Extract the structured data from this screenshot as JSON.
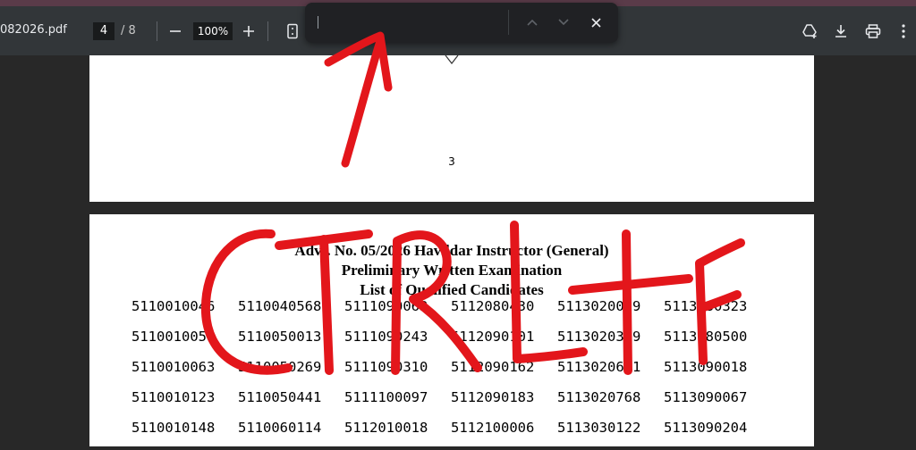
{
  "toolbar": {
    "filename": "082026.pdf",
    "current_page": "4",
    "page_separator": "/",
    "total_pages": "8",
    "zoom": "100%",
    "icons": [
      "minus-icon",
      "plus-icon",
      "page-fit-icon",
      "add-drive-icon",
      "download-icon",
      "print-icon",
      "more-vert-icon"
    ]
  },
  "find_bar": {
    "value": "",
    "icons": [
      "chevron-up-icon",
      "chevron-down-icon",
      "close-icon"
    ]
  },
  "page1": {
    "page_number": "3"
  },
  "page2": {
    "heading_line1": "Advt. No. 05/2026 Havildar Instructor (General)",
    "heading_line2": "Preliminary Written Examination",
    "heading_line3": "List of Qualified Candidates",
    "rows": [
      [
        "5110010046",
        "5110040568",
        "5111090063",
        "5112080430",
        "5113020079",
        "5113080323"
      ],
      [
        "5110010058",
        "5110050013",
        "5111090243",
        "5112090101",
        "5113020309",
        "5113080500"
      ],
      [
        "5110010063",
        "5110050269",
        "5111090310",
        "5112090162",
        "5113020651",
        "5113090018"
      ],
      [
        "5110010123",
        "5110050441",
        "5111100097",
        "5112090183",
        "5113020768",
        "5113090067"
      ],
      [
        "5110010148",
        "5110060114",
        "5112010018",
        "5112100006",
        "5113030122",
        "5113090204"
      ]
    ]
  },
  "annotation": {
    "text": "CTRL+F",
    "color": "#e3161b",
    "icons": [
      "hand-drawn-arrow-icon"
    ]
  },
  "colors": {
    "toolbar_bg": "#323639",
    "viewer_bg": "#282828",
    "findbar_bg": "#202124",
    "annotation_red": "#e3161b"
  }
}
